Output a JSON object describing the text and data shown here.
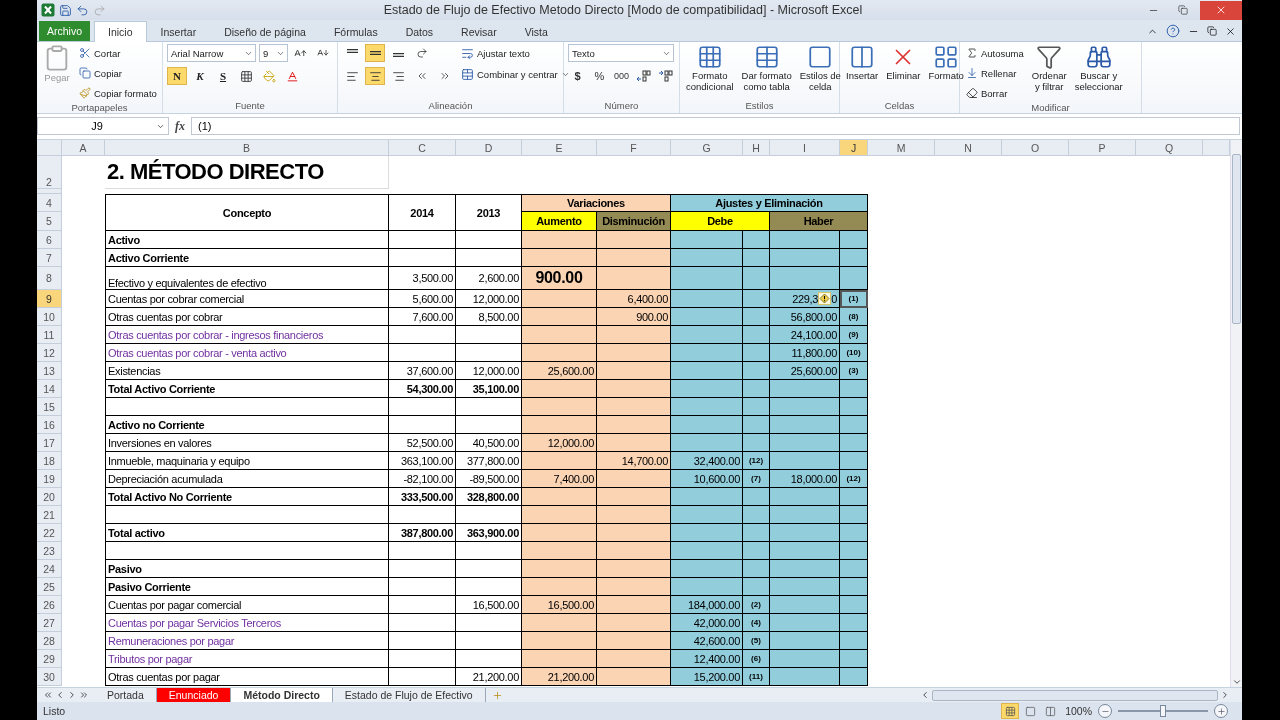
{
  "window": {
    "title": "Estado de Flujo de Efectivo Metodo Directo  [Modo de compatibilidad]  -  Microsoft Excel"
  },
  "ribbon_tabs": [
    {
      "label": "Archivo",
      "kind": "file",
      "selected": false
    },
    {
      "label": "Inicio",
      "kind": "tab",
      "selected": true
    },
    {
      "label": "Insertar",
      "kind": "tab",
      "selected": false
    },
    {
      "label": "Diseño de página",
      "kind": "tab",
      "selected": false
    },
    {
      "label": "Fórmulas",
      "kind": "tab",
      "selected": false
    },
    {
      "label": "Datos",
      "kind": "tab",
      "selected": false
    },
    {
      "label": "Revisar",
      "kind": "tab",
      "selected": false
    },
    {
      "label": "Vista",
      "kind": "tab",
      "selected": false
    }
  ],
  "clipboard": {
    "label": "Portapapeles",
    "paste": "Pegar",
    "paste_disabled": true,
    "cut": "Cortar",
    "copy": "Copiar",
    "format_painter": "Copiar formato"
  },
  "font": {
    "label": "Fuente",
    "name": "Arial Narrow",
    "size": "9",
    "styles": [
      {
        "label": "N",
        "kind": "bold",
        "on": true
      },
      {
        "label": "K",
        "kind": "italic",
        "on": false
      },
      {
        "label": "S",
        "kind": "underline",
        "on": false
      }
    ]
  },
  "alignment": {
    "label": "Alineación",
    "vertical": [
      {
        "kind": "top",
        "selected": false
      },
      {
        "kind": "middle",
        "selected": true
      },
      {
        "kind": "bottom",
        "selected": false
      }
    ],
    "horizontal": [
      {
        "kind": "left",
        "selected": false
      },
      {
        "kind": "center",
        "selected": true
      },
      {
        "kind": "right",
        "selected": false
      }
    ],
    "wrap": "Ajustar texto",
    "merge": "Combinar y centrar"
  },
  "number": {
    "label": "Número",
    "format": "Texto",
    "currency": "$",
    "percent": "%",
    "thousands": "000"
  },
  "styles": {
    "label": "Estilos",
    "buttons": [
      {
        "lines": [
          "Formato",
          "condicional"
        ],
        "kind": "conditional"
      },
      {
        "lines": [
          "Dar formato",
          "como tabla"
        ],
        "kind": "table"
      },
      {
        "lines": [
          "Estilos de",
          "celda"
        ],
        "kind": "cell"
      }
    ]
  },
  "cells": {
    "label": "Celdas",
    "buttons": [
      {
        "label": "Insertar",
        "kind": "insert"
      },
      {
        "label": "Eliminar",
        "kind": "delete"
      },
      {
        "label": "Formato",
        "kind": "format"
      }
    ]
  },
  "editing": {
    "label": "Modificar",
    "autosum": "Autosuma",
    "fill": "Rellenar",
    "clear": "Borrar",
    "sort": [
      "Ordenar",
      "y filtrar"
    ],
    "find": [
      "Buscar y",
      "seleccionar"
    ]
  },
  "formula_bar": {
    "name_box": "J9",
    "function_label": "fx",
    "formula": "(1)"
  },
  "sheet": {
    "columns": [
      {
        "label": "A",
        "selected": false
      },
      {
        "label": "B",
        "selected": false
      },
      {
        "label": "C",
        "selected": false
      },
      {
        "label": "D",
        "selected": false
      },
      {
        "label": "E",
        "selected": false
      },
      {
        "label": "F",
        "selected": false
      },
      {
        "label": "G",
        "selected": false
      },
      {
        "label": "H",
        "selected": false
      },
      {
        "label": "I",
        "selected": false
      },
      {
        "label": "J",
        "selected": true
      },
      {
        "label": "M",
        "selected": false
      },
      {
        "label": "N",
        "selected": false
      },
      {
        "label": "O",
        "selected": false
      },
      {
        "label": "P",
        "selected": false
      },
      {
        "label": "Q",
        "selected": false
      }
    ],
    "title_row": "2",
    "title": "2. MÉTODO DIRECTO",
    "header_rows": [
      "4",
      "5"
    ],
    "header": {
      "concept": "Concepto",
      "years": [
        "2014",
        "2013"
      ],
      "variations": "Variaciones",
      "increase": "Aumento",
      "decrease": "Disminución",
      "adjustments": "Ajustes y Eliminación",
      "debit": "Debe",
      "credit": "Haber"
    },
    "rows": [
      {
        "n": "6",
        "kind": "heading",
        "concept": "Activo",
        "selected": false,
        "emphasis": false,
        "warning": false
      },
      {
        "n": "7",
        "kind": "heading",
        "concept": "Activo Corriente",
        "selected": false,
        "emphasis": false,
        "warning": false
      },
      {
        "n": "8",
        "kind": "item",
        "concept": "Efectivo y equivalentes de efectivo",
        "y2014": "3,500.00",
        "y2013": "2,600.00",
        "aumento": "900.00",
        "selected": false,
        "emphasis": true,
        "warning": false
      },
      {
        "n": "9",
        "kind": "item",
        "concept": "Cuentas por cobrar comercial",
        "y2014": "5,600.00",
        "y2013": "12,000.00",
        "disminucion": "6,400.00",
        "haber": "229,3",
        "haber_tail": "0",
        "haber_ref": "(1)",
        "selected": true,
        "emphasis": false,
        "warning": true
      },
      {
        "n": "10",
        "kind": "item",
        "concept": "Otras cuentas por cobrar",
        "y2014": "7,600.00",
        "y2013": "8,500.00",
        "disminucion": "900.00",
        "haber": "56,800.00",
        "haber_ref": "(8)",
        "selected": false,
        "emphasis": false,
        "warning": false
      },
      {
        "n": "11",
        "kind": "linked",
        "concept": "Otras cuentas por cobrar - ingresos financieros",
        "haber": "24,100.00",
        "haber_ref": "(9)",
        "selected": false,
        "emphasis": false,
        "warning": false
      },
      {
        "n": "12",
        "kind": "linked",
        "concept": "Otras cuentas por cobrar - venta activo",
        "haber": "11,800.00",
        "haber_ref": "(10)",
        "selected": false,
        "emphasis": false,
        "warning": false
      },
      {
        "n": "13",
        "kind": "item",
        "concept": "Existencias",
        "y2014": "37,600.00",
        "y2013": "12,000.00",
        "aumento": "25,600.00",
        "haber": "25,600.00",
        "haber_ref": "(3)",
        "selected": false,
        "emphasis": false,
        "warning": false
      },
      {
        "n": "14",
        "kind": "total",
        "concept": "Total Activo Corriente",
        "y2014": "54,300.00",
        "y2013": "35,100.00",
        "selected": false,
        "emphasis": false,
        "warning": false
      },
      {
        "n": "15",
        "kind": "blank",
        "selected": false,
        "emphasis": false,
        "warning": false
      },
      {
        "n": "16",
        "kind": "heading",
        "concept": "Activo no Corriente",
        "selected": false,
        "emphasis": false,
        "warning": false
      },
      {
        "n": "17",
        "kind": "item",
        "concept": "Inversiones en valores",
        "y2014": "52,500.00",
        "y2013": "40,500.00",
        "aumento": "12,000.00",
        "selected": false,
        "emphasis": false,
        "warning": false
      },
      {
        "n": "18",
        "kind": "item",
        "concept": "Inmueble, maquinaria y equipo",
        "y2014": "363,100.00",
        "y2013": "377,800.00",
        "disminucion": "14,700.00",
        "debe": "32,400.00",
        "debe_ref": "(12)",
        "selected": false,
        "emphasis": false,
        "warning": false
      },
      {
        "n": "19",
        "kind": "item",
        "concept": "Depreciación acumulada",
        "y2014": "-82,100.00",
        "y2013": "-89,500.00",
        "aumento": "7,400.00",
        "debe": "10,600.00",
        "debe_ref": "(7)",
        "haber": "18,000.00",
        "haber_ref": "(12)",
        "selected": false,
        "emphasis": false,
        "warning": false
      },
      {
        "n": "20",
        "kind": "total",
        "concept": "Total Activo No Corriente",
        "y2014": "333,500.00",
        "y2013": "328,800.00",
        "selected": false,
        "emphasis": false,
        "warning": false
      },
      {
        "n": "21",
        "kind": "blank",
        "selected": false,
        "emphasis": false,
        "warning": false
      },
      {
        "n": "22",
        "kind": "total",
        "concept": "Total activo",
        "y2014": "387,800.00",
        "y2013": "363,900.00",
        "selected": false,
        "emphasis": false,
        "warning": false
      },
      {
        "n": "23",
        "kind": "blank",
        "selected": false,
        "emphasis": false,
        "warning": false
      },
      {
        "n": "24",
        "kind": "heading",
        "concept": "Pasivo",
        "selected": false,
        "emphasis": false,
        "warning": false
      },
      {
        "n": "25",
        "kind": "heading",
        "concept": "Pasivo Corriente",
        "selected": false,
        "emphasis": false,
        "warning": false
      },
      {
        "n": "26",
        "kind": "item",
        "concept": "Cuentas por pagar comercial",
        "y2013": "16,500.00",
        "aumento": "16,500.00",
        "debe": "184,000.00",
        "debe_ref": "(2)",
        "selected": false,
        "emphasis": false,
        "warning": false
      },
      {
        "n": "27",
        "kind": "linked",
        "concept": "Cuentas por pagar Servicios Terceros",
        "debe": "42,000.00",
        "debe_ref": "(4)",
        "selected": false,
        "emphasis": false,
        "warning": false
      },
      {
        "n": "28",
        "kind": "linked",
        "concept": "Remuneraciones por pagar",
        "debe": "42,600.00",
        "debe_ref": "(5)",
        "selected": false,
        "emphasis": false,
        "warning": false
      },
      {
        "n": "29",
        "kind": "linked",
        "concept": "Tributos por pagar",
        "debe": "12,400.00",
        "debe_ref": "(6)",
        "selected": false,
        "emphasis": false,
        "warning": false
      },
      {
        "n": "30",
        "kind": "item",
        "concept": "Otras cuentas por pagar",
        "y2013": "21,200.00",
        "aumento": "21,200.00",
        "debe": "15,200.00",
        "debe_ref": "(11)",
        "selected": false,
        "emphasis": false,
        "warning": false
      }
    ]
  },
  "sheet_tabs": [
    {
      "label": "Portada",
      "selected": false
    },
    {
      "label": "Enunciado",
      "selected": false,
      "color": "#ff0000"
    },
    {
      "label": "Método Directo",
      "selected": true
    },
    {
      "label": "Estado de Flujo de Efectivo",
      "selected": false
    }
  ],
  "status_bar": {
    "status": "Listo",
    "views": [
      {
        "kind": "normal",
        "selected": true
      },
      {
        "kind": "layout",
        "selected": false
      },
      {
        "kind": "break",
        "selected": false
      }
    ],
    "zoom": {
      "label": "100%",
      "level": 0.5
    }
  }
}
